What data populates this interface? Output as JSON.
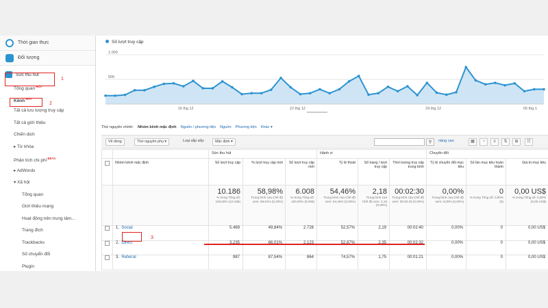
{
  "sidebar": {
    "realtime": "Thời gian thực",
    "audience": "Đối tượng",
    "acquisition": "Sức thu hút",
    "overview": "Tổng quan",
    "channels": "Kênh",
    "new_badge": "MỚI",
    "beta_badge": "BETA",
    "items": [
      {
        "label": "Tất cả lưu lượng truy cập"
      },
      {
        "label": "Tất cả giới thiệu"
      },
      {
        "label": "Chiến dịch"
      },
      {
        "label": "▸ Từ khóa"
      },
      {
        "label": "Phân tích chi phí"
      },
      {
        "label": "▸ AdWords"
      },
      {
        "label": "▾ Xã hội"
      }
    ],
    "social_items": [
      {
        "label": "Tổng quan"
      },
      {
        "label": "Giới thiệu mạng"
      },
      {
        "label": "Hoạt động trên trung tâm..."
      },
      {
        "label": "Trang đích"
      },
      {
        "label": "Trackbacks"
      },
      {
        "label": "Số chuyển đổi"
      },
      {
        "label": "Plugin"
      }
    ],
    "annotations": [
      "1",
      "2",
      "3"
    ]
  },
  "chart": {
    "legend": "Số lượt truy cập",
    "colors": {
      "line": "#2c93d1",
      "fill": "#cfe5f5"
    }
  },
  "chart_data": {
    "type": "area",
    "series": [
      {
        "name": "Số lượt truy cập",
        "values": [
          170,
          170,
          185,
          280,
          280,
          350,
          410,
          420,
          360,
          470,
          320,
          320,
          460,
          340,
          200,
          220,
          220,
          290,
          530,
          340,
          200,
          220,
          300,
          220,
          300,
          460,
          570,
          190,
          220,
          350,
          260,
          360,
          180,
          430,
          230,
          190,
          240,
          750,
          480,
          400,
          430,
          380,
          420,
          260,
          300,
          300
        ]
      }
    ],
    "y_ticks": [
      "1.000",
      "500"
    ],
    "x_labels": [
      "15 thg 12",
      "22 thg 12",
      "29 thg 12",
      "05 thg 1"
    ],
    "ylim": [
      0,
      1000
    ]
  },
  "tabs": [
    {
      "label": "Thứ nguyên chính:",
      "style": "plain"
    },
    {
      "label": "Nhóm kênh mặc định",
      "style": "active"
    },
    {
      "label": "Nguồn / phương tiện",
      "style": "link"
    },
    {
      "label": "Nguồn",
      "style": "link"
    },
    {
      "label": "Phương tiện",
      "style": "link"
    },
    {
      "label": "Khác ▾",
      "style": "link"
    }
  ],
  "toolbar": {
    "plot_rows": "Vẽ dòng",
    "secondary_dimension": "Thứ nguyên phụ",
    "sort_type": "Loại sắp xếp:",
    "sort_value": "Mặc định",
    "advanced": "nâng cao"
  },
  "table": {
    "groups": [
      "Sức thu hút",
      "Hành vi",
      "Chuyển đổi"
    ],
    "column_name_header": "Nhóm kênh mặc định",
    "columns": [
      "Số lượt truy cập",
      "% lượt truy cập mới",
      "Số lượt truy cập mới",
      "Tỷ lệ thoát",
      "Số trang / lượt truy cập",
      "Thời lượng truy cập trung bình",
      "Tỷ lệ chuyển đổi mục tiêu",
      "Số lần mục tiêu hoàn thành",
      "Giá trị mục tiêu"
    ],
    "totals": [
      {
        "value": "10.186",
        "note": "% trong Tổng số: 100,00% (10.186)"
      },
      {
        "value": "58,98%",
        "note": "Trung bình của Chế độ xem: 58,81% (0,29%)"
      },
      {
        "value": "6.008",
        "note": "% trong Tổng số: 100,00% (6.008)"
      },
      {
        "value": "54,46%",
        "note": "Trung bình của Chế độ xem: 54,46% (0,00%)"
      },
      {
        "value": "2,18",
        "note": "Trung bình của Chế độ xem: 2,18 (0,00%)"
      },
      {
        "value": "00:02:30",
        "note": "Trung bình của Chế độ xem: 00:02:30 (0,00%)"
      },
      {
        "value": "0,00%",
        "note": "Trung bình của Chế độ xem: 0,00% (0,00%)"
      },
      {
        "value": "0",
        "note": "% trong Tổng số: 0,00% (0)"
      },
      {
        "value": "0,00 US$",
        "note": "% trong Tổng số: 0,00% (0,00 US$)"
      }
    ],
    "rows": [
      {
        "index": "1.",
        "name": "Social",
        "cells": [
          "5.469",
          "49,84%",
          "2.726",
          "52,57%",
          "2,19",
          "00:02:40",
          "0,00%",
          "0",
          "0,00 US$"
        ]
      },
      {
        "index": "2.",
        "name": "Direct",
        "cells": [
          "3.235",
          "66,01%",
          "2.123",
          "52,87%",
          "2,35",
          "00:02:32",
          "0,00%",
          "0",
          "0,00 US$"
        ]
      },
      {
        "index": "3.",
        "name": "Referral",
        "cells": [
          "987",
          "87,54%",
          "864",
          "74,57%",
          "1,75",
          "00:01:21",
          "0,00%",
          "0",
          "0,00 US$"
        ]
      }
    ]
  }
}
